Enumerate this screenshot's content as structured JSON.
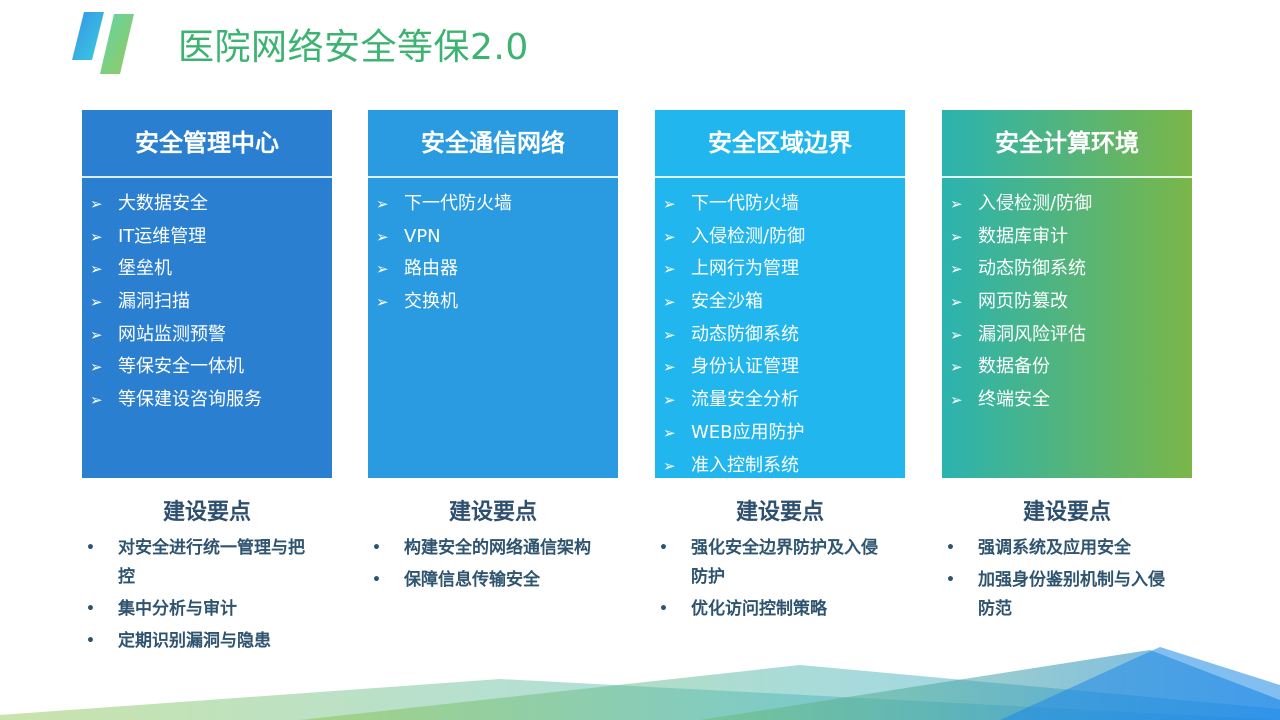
{
  "title": "医院网络安全等保2.0",
  "columns": [
    {
      "heading": "安全管理中心",
      "items": [
        "大数据安全",
        "IT运维管理",
        "堡垒机",
        "漏洞扫描",
        "网站监测预警",
        "等保安全一体机",
        "等保建设咨询服务"
      ],
      "key_title": "建设要点",
      "points": [
        "对安全进行统一管理与把控",
        "集中分析与审计",
        "定期识别漏洞与隐患"
      ]
    },
    {
      "heading": "安全通信网络",
      "items": [
        "下一代防火墙",
        "VPN",
        "路由器",
        "交换机"
      ],
      "key_title": "建设要点",
      "points": [
        "构建安全的网络通信架构",
        "保障信息传输安全"
      ]
    },
    {
      "heading": "安全区域边界",
      "items": [
        "下一代防火墙",
        "入侵检测/防御",
        "上网行为管理",
        "安全沙箱",
        "动态防御系统",
        "身份认证管理",
        "流量安全分析",
        "WEB应用防护",
        "准入控制系统"
      ],
      "key_title": "建设要点",
      "points": [
        "强化安全边界防护及入侵防护",
        "优化访问控制策略"
      ]
    },
    {
      "heading": "安全计算环境",
      "items": [
        "入侵检测/防御",
        "数据库审计",
        "动态防御系统",
        "网页防篡改",
        "漏洞风险评估",
        "数据备份",
        "终端安全"
      ],
      "key_title": "建设要点",
      "points": [
        "强调系统及应用安全",
        "加强身份鉴别机制与入侵防范"
      ]
    }
  ],
  "colors": {
    "title": "#3cb371",
    "col1": "#2b7fd0",
    "col2": "#2a9be0",
    "col3": "#22b6ee",
    "col4_start": "#2bb3b0",
    "col4_end": "#7ab648",
    "key_text": "#2f5470"
  }
}
